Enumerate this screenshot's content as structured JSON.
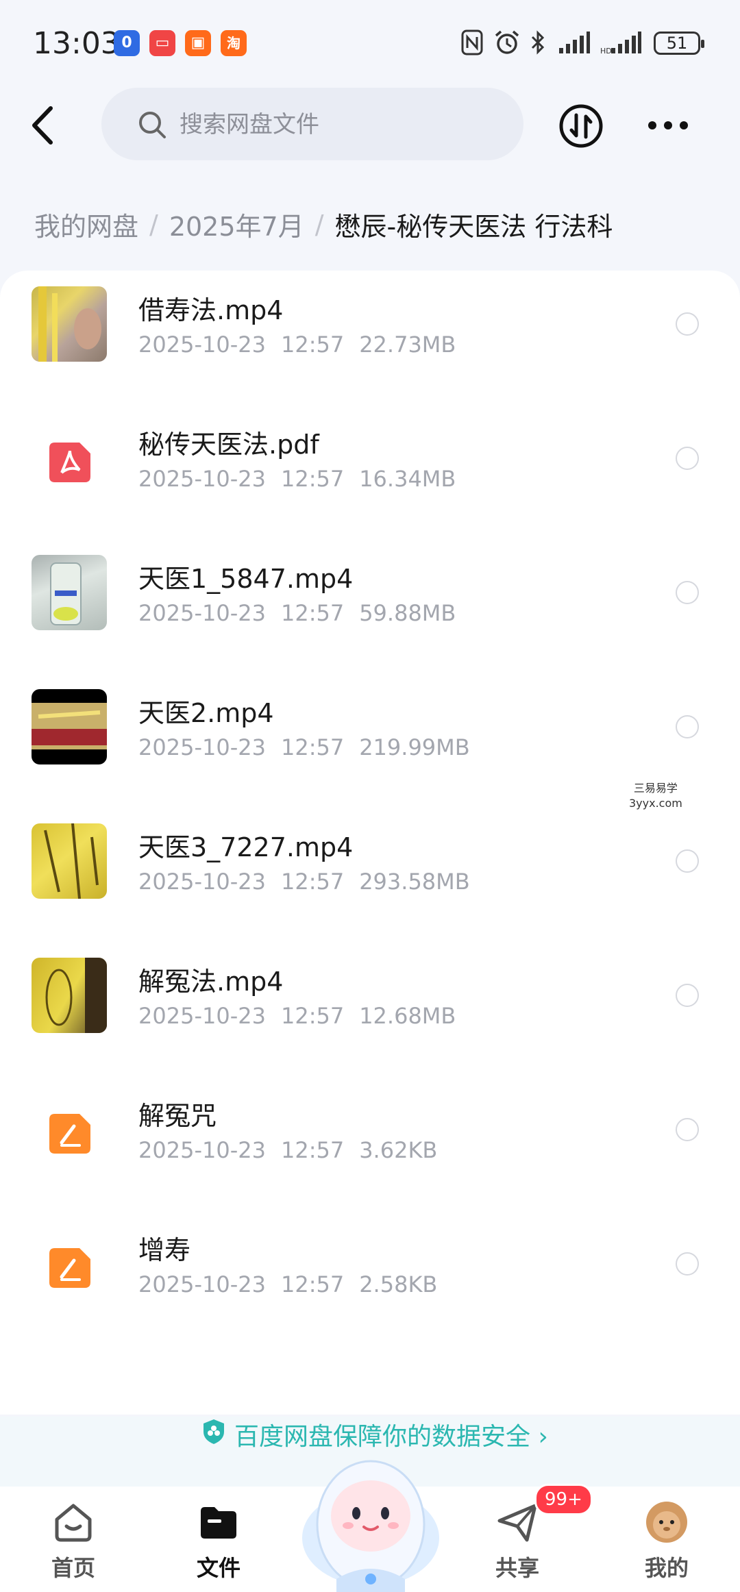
{
  "status_bar": {
    "time": "13:03",
    "battery": "51",
    "app_icons": [
      {
        "name": "calendar-app-icon",
        "color": "#2f6be3",
        "glyph": "0"
      },
      {
        "name": "red-app-icon",
        "color": "#f04545",
        "glyph": "▭"
      },
      {
        "name": "orange-app-icon",
        "color": "#ff6a1a",
        "glyph": "▣"
      },
      {
        "name": "taobao-app-icon",
        "color": "#ff6a1a",
        "glyph": "淘"
      }
    ]
  },
  "header": {
    "search_placeholder": "搜索网盘文件"
  },
  "breadcrumb": {
    "items": [
      "我的网盘",
      "2025年7月"
    ],
    "current": "懋辰-秘传天医法 行法科"
  },
  "files": [
    {
      "name": "借寿法.mp4",
      "date": "2025-10-23",
      "time": "12:57",
      "size": "22.73MB",
      "icon": "video-thumbnail"
    },
    {
      "name": "秘传天医法.pdf",
      "date": "2025-10-23",
      "time": "12:57",
      "size": "16.34MB",
      "icon": "pdf-icon"
    },
    {
      "name": "天医1_5847.mp4",
      "date": "2025-10-23",
      "time": "12:57",
      "size": "59.88MB",
      "icon": "video-thumbnail"
    },
    {
      "name": "天医2.mp4",
      "date": "2025-10-23",
      "time": "12:57",
      "size": "219.99MB",
      "icon": "video-thumbnail"
    },
    {
      "name": "天医3_7227.mp4",
      "date": "2025-10-23",
      "time": "12:57",
      "size": "293.58MB",
      "icon": "video-thumbnail"
    },
    {
      "name": "解冤法.mp4",
      "date": "2025-10-23",
      "time": "12:57",
      "size": "12.68MB",
      "icon": "video-thumbnail"
    },
    {
      "name": "解冤咒",
      "date": "2025-10-23",
      "time": "12:57",
      "size": "3.62KB",
      "icon": "note-icon"
    },
    {
      "name": "增寿",
      "date": "2025-10-23",
      "time": "12:57",
      "size": "2.58KB",
      "icon": "note-icon"
    }
  ],
  "watermark": {
    "line1": "三易易学",
    "line2": "3yyx.com"
  },
  "safety_banner": {
    "text": "百度网盘保障你的数据安全"
  },
  "tabbar": {
    "tabs": [
      {
        "label": "首页",
        "icon": "home-icon"
      },
      {
        "label": "文件",
        "icon": "folder-icon",
        "active": true
      },
      {
        "label": "共享",
        "icon": "paper-plane-icon",
        "badge": "99+"
      },
      {
        "label": "我的",
        "icon": "avatar"
      }
    ]
  },
  "colors": {
    "accent": "#2bb7b0",
    "pdf": "#f0505a",
    "note": "#ff8a2a"
  }
}
